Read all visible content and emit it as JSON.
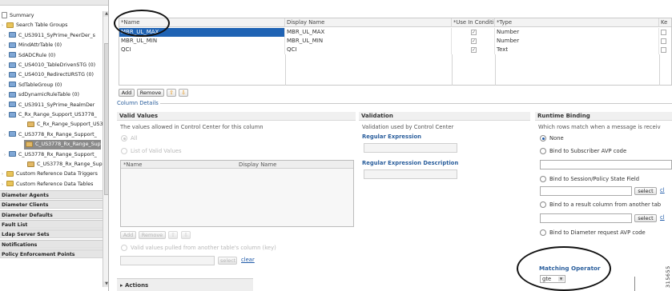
{
  "tree": {
    "items": [
      {
        "label": "Summary",
        "depth": 0,
        "icon": "doc"
      },
      {
        "label": "Search Table Groups",
        "depth": 0,
        "icon": "folder"
      },
      {
        "label": "C_US3911_SyPrime_PeerDer_s",
        "depth": 1,
        "icon": "table"
      },
      {
        "label": "MindAttrTable (0)",
        "depth": 1,
        "icon": "table"
      },
      {
        "label": "SdADCRule (0)",
        "depth": 1,
        "icon": "table"
      },
      {
        "label": "C_US4010_TableDrivenSTG (0)",
        "depth": 1,
        "icon": "table"
      },
      {
        "label": "C_US4010_RedirectURSTG (0)",
        "depth": 1,
        "icon": "table"
      },
      {
        "label": "SdTableGroup (0)",
        "depth": 1,
        "icon": "table"
      },
      {
        "label": "sdDynamicRuleTable (0)",
        "depth": 1,
        "icon": "table"
      },
      {
        "label": "C_US3911_SyPrime_RealmDer",
        "depth": 1,
        "icon": "table"
      },
      {
        "label": "C_Rx_Range_Support_US3778_",
        "depth": 1,
        "icon": "table"
      },
      {
        "label": "C_Rx_Range_Support_US37",
        "depth": 2,
        "icon": "tbl2"
      },
      {
        "label": "C_US3778_Rx_Range_Support_",
        "depth": 1,
        "icon": "table"
      },
      {
        "label": "C_US3778_Rx_Range_Supp",
        "depth": 2,
        "icon": "tbl2",
        "selected": true
      },
      {
        "label": "C_US3778_Rx_Range_Support_",
        "depth": 1,
        "icon": "table"
      },
      {
        "label": "C_US3778_Rx_Range_Supp",
        "depth": 2,
        "icon": "tbl2"
      },
      {
        "label": "Custom Reference Data Triggers",
        "depth": 0,
        "icon": "folder"
      },
      {
        "label": "Custom Reference Data Tables",
        "depth": 0,
        "icon": "folder"
      }
    ],
    "sections": [
      "Diameter Agents",
      "Diameter Clients",
      "Diameter Defaults",
      "Fault List",
      "Ldap Server Sets",
      "Notifications",
      "Policy Enforcement Points"
    ]
  },
  "grid": {
    "columns": [
      "*Name",
      "Display Name",
      "*Use In Conditi",
      "*Type",
      "Ke"
    ],
    "rows": [
      {
        "name": "MBR_UL_MAX",
        "display": "MBR_UL_MAX",
        "use": "✓",
        "type": "Number"
      },
      {
        "name": "MBR_UL_MIN",
        "display": "MBR_UL_MIN",
        "use": "✓",
        "type": "Number"
      },
      {
        "name": "QCI",
        "display": "QCI",
        "use": "✓",
        "type": "Text"
      }
    ],
    "add_label": "Add",
    "remove_label": "Remove"
  },
  "column_details_label": "Column Details",
  "valid_values": {
    "header": "Valid Values",
    "desc": "The values allowed in Control Center for this column",
    "all_label": "All",
    "list_label": "List of Valid Values",
    "table_cols": [
      "*Name",
      "Display Name"
    ],
    "add_label": "Add",
    "remove_label": "Remove",
    "pulled_label": "Valid values pulled from another table's column (key)",
    "select_label": "select",
    "clear_label": "clear"
  },
  "validation": {
    "header": "Validation",
    "desc": "Validation used by Control Center",
    "regex_label": "Regular Expression",
    "regex_desc_label": "Regular Expression Description"
  },
  "runtime": {
    "header": "Runtime Binding",
    "desc": "Which rows match when a message is receiv",
    "none_label": "None",
    "avp_label": "Bind to Subscriber AVP code",
    "session_label": "Bind to Session/Policy State Field",
    "result_label": "Bind to a result column from another tab",
    "diameter_label": "Bind to Diameter request AVP code",
    "select_label": "select",
    "clear_short": "cl",
    "matching_label": "Matching Operator",
    "matching_value": "gte"
  },
  "actions_label": "Actions",
  "side_code": "315655"
}
